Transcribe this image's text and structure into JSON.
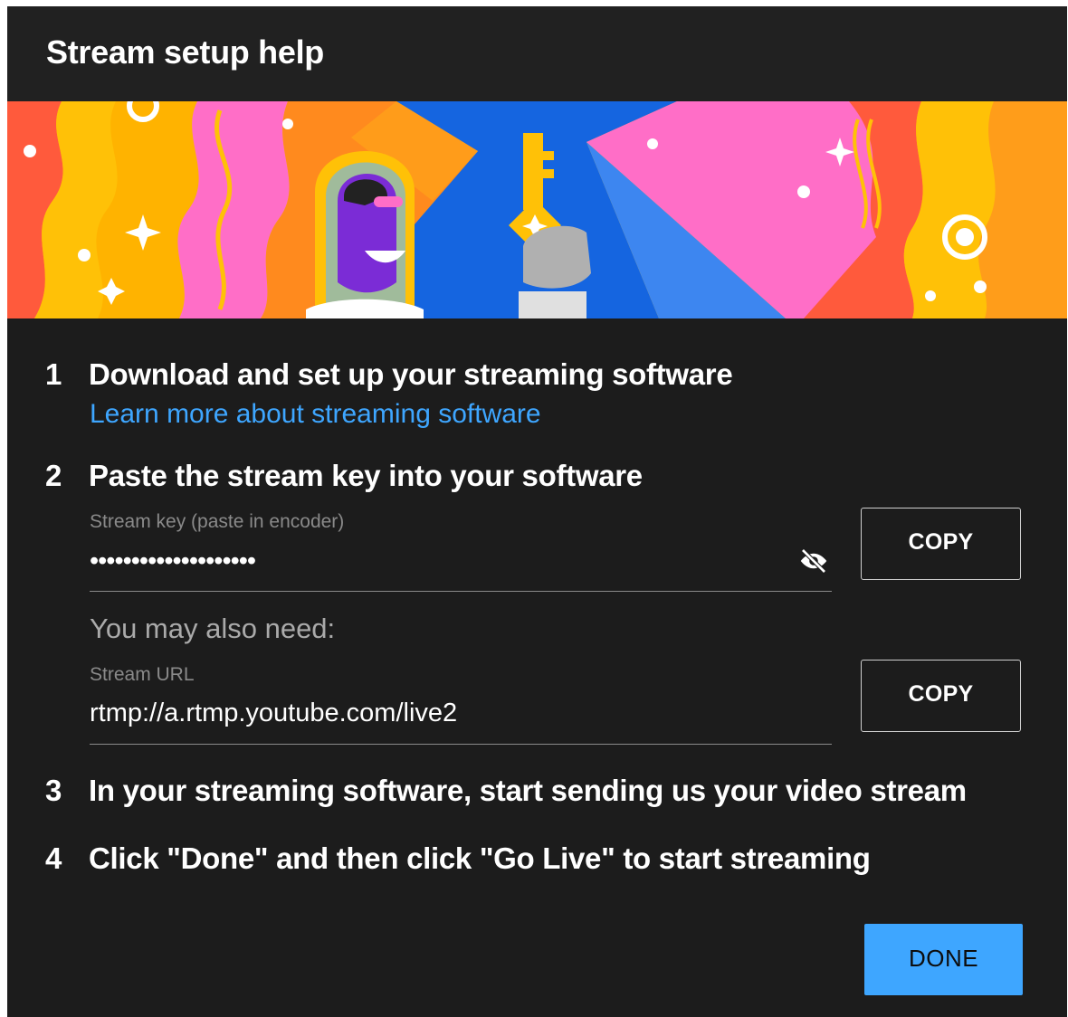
{
  "dialog": {
    "title": "Stream setup help"
  },
  "steps": [
    {
      "number": "1",
      "text": "Download and set up your streaming software"
    },
    {
      "number": "2",
      "text": "Paste the stream key into your software"
    },
    {
      "number": "3",
      "text": "In your streaming software, start sending us your video stream"
    },
    {
      "number": "4",
      "text": "Click \"Done\" and then click \"Go Live\" to start streaming"
    }
  ],
  "learn_link": "Learn more about streaming software",
  "stream_key": {
    "label": "Stream key (paste in encoder)",
    "value": "••••••••••••••••••••",
    "visibility_icon": "eye-off-icon",
    "copy_label": "COPY"
  },
  "also_need": "You may also need:",
  "stream_url": {
    "label": "Stream URL",
    "value": "rtmp://a.rtmp.youtube.com/live2",
    "copy_label": "COPY"
  },
  "done_label": "DONE",
  "colors": {
    "background": "#1c1c1c",
    "header": "#212121",
    "link": "#3ea6ff",
    "primary_button": "#3ea6ff",
    "muted_text": "#aaaaaa"
  }
}
